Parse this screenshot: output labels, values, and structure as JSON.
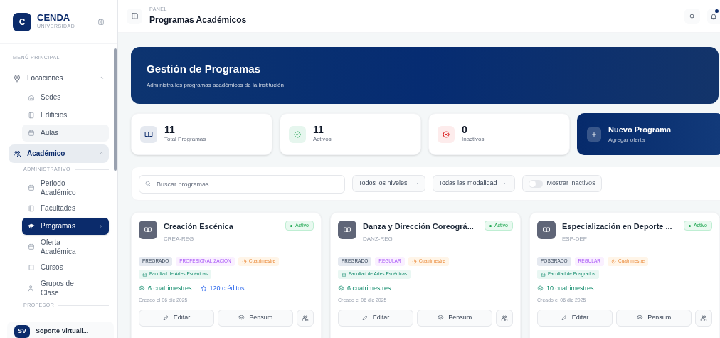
{
  "sidebar": {
    "brand": {
      "initial": "C",
      "name": "CENDA",
      "subtitle": "UNIVERSIDAD"
    },
    "menu_label": "MENÚ PRINCIPAL",
    "items": [
      {
        "label": "Locaciones",
        "expanded": true,
        "selected": false,
        "children": [
          {
            "label": "Sedes",
            "kind": "link",
            "selected": false
          },
          {
            "label": "Edificios",
            "kind": "link",
            "selected": false
          },
          {
            "label": "Aulas",
            "kind": "link",
            "selected": false,
            "hovered": true
          }
        ]
      },
      {
        "label": "Académico",
        "expanded": true,
        "selected": true,
        "children": [
          {
            "label": "ADMINISTRATIVO",
            "kind": "heading",
            "selected": false
          },
          {
            "label": "Periodo Académico",
            "kind": "link",
            "selected": false
          },
          {
            "label": "Facultades",
            "kind": "link",
            "selected": false
          },
          {
            "label": "Programas",
            "kind": "link",
            "selected": true
          },
          {
            "label": "Oferta Académica",
            "kind": "link",
            "selected": false
          },
          {
            "label": "Cursos",
            "kind": "link",
            "selected": false
          },
          {
            "label": "Grupos de Clase",
            "kind": "link",
            "selected": false
          },
          {
            "label": "PROFESOR",
            "kind": "heading",
            "selected": false
          }
        ]
      }
    ],
    "user": {
      "initials": "SV",
      "name": "Soporte Virtuali..."
    }
  },
  "header": {
    "eyebrow": "PANEL",
    "title": "Programas Académicos",
    "notification": true
  },
  "banner": {
    "title": "Gestión de Programas",
    "subtitle": "Administra los programas académicos de la institución"
  },
  "stats": [
    {
      "kind": "total",
      "value": "11",
      "label": "Total Programas"
    },
    {
      "kind": "active",
      "value": "11",
      "label": "Activos"
    },
    {
      "kind": "inactive",
      "value": "0",
      "label": "Inactivos"
    }
  ],
  "new_button": {
    "title": "Nuevo Programa",
    "subtitle": "Agregar oferta"
  },
  "filters": {
    "search": {
      "placeholder": "Buscar programas..."
    },
    "selects": [
      "Todos los niveles",
      "Todas las modalidad"
    ],
    "toggle": {
      "label": "Mostrar inactivos",
      "on": false
    }
  },
  "programs": [
    {
      "name": "Creación Escénica",
      "code": "CREA-REG",
      "status": "Activo",
      "tags": [
        {
          "kind": "level",
          "label": "PREGRADO"
        },
        {
          "kind": "modality",
          "label": "PROFESIONALIZACION"
        },
        {
          "kind": "period",
          "label": "Cuatrimestre"
        },
        {
          "kind": "faculty",
          "label": "Facultad de Artes Escénicas"
        }
      ],
      "terms": "6 cuatrimestres",
      "credits": "120 créditos",
      "created": "Creado el 06 dic 2025",
      "actions": [
        "Editar",
        "Pensum"
      ]
    },
    {
      "name": "Danza y Dirección Coreográ...",
      "code": "DANZ-REG",
      "status": "Activo",
      "tags": [
        {
          "kind": "level",
          "label": "PREGRADO"
        },
        {
          "kind": "modality",
          "label": "REGULAR"
        },
        {
          "kind": "period",
          "label": "Cuatrimestre"
        },
        {
          "kind": "faculty",
          "label": "Facultad de Artes Escénicas"
        }
      ],
      "terms": "6 cuatrimestres",
      "created": "Creado el 06 dic 2025",
      "actions": [
        "Editar",
        "Pensum"
      ]
    },
    {
      "name": "Especialización en Deporte ...",
      "code": "ESP-DEP",
      "status": "Activo",
      "tags": [
        {
          "kind": "level",
          "label": "POSGRADO"
        },
        {
          "kind": "modality",
          "label": "REGULAR"
        },
        {
          "kind": "period",
          "label": "Cuatrimestre"
        },
        {
          "kind": "faculty",
          "label": "Facultad de Posgrados"
        }
      ],
      "terms": "10 cuatrimestres",
      "created": "Creado el 06 dic 2025",
      "actions": [
        "Editar",
        "Pensum"
      ]
    }
  ]
}
